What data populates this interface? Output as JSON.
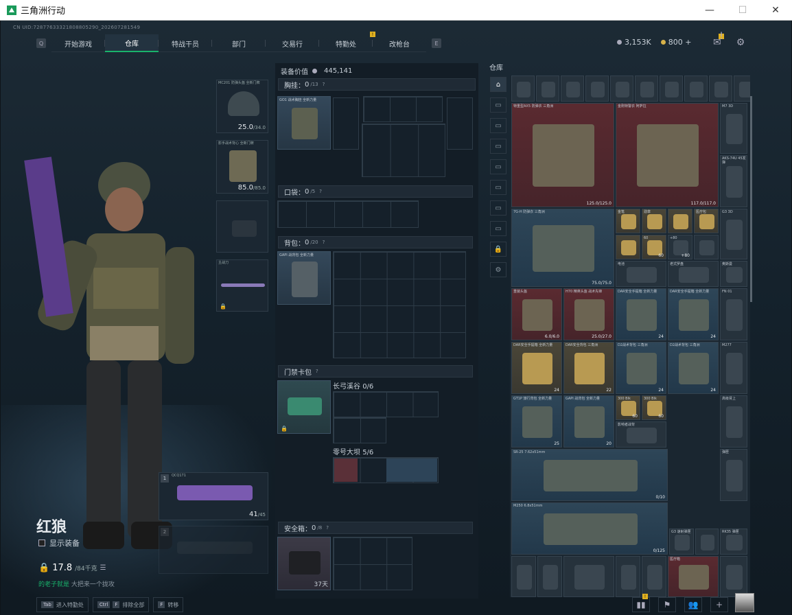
{
  "window": {
    "title": "三角洲行动",
    "min": "—",
    "max": "☐",
    "close": "✕"
  },
  "uid": "CN UID:72877633321808805290_202607281549",
  "nav": {
    "left_key": "Q",
    "right_key": "E",
    "tabs": [
      "开始游戏",
      "仓库",
      "特战干员",
      "部门",
      "交易行",
      "特勤处",
      "改枪台"
    ],
    "active": "仓库",
    "badge": "!"
  },
  "currency": {
    "silver": "3,153K",
    "gold": "800",
    "plus": "+"
  },
  "character": {
    "name": "红狼",
    "show_equipment": "显示装备",
    "weight": "17.8",
    "weight_max": "/84千克",
    "taunt_prefix": "",
    "taunt_main": "的老子就是",
    "taunt_suffix": "大把来一个拢攻"
  },
  "equip_slots": {
    "helmet": {
      "label": "MC201 防弹头盔 全新门牌",
      "value": "25.0",
      "max": "/34.0"
    },
    "armor": {
      "label": "影手战术背心 全新门牌",
      "value": "85.0",
      "max": "/85.0"
    },
    "pistol": {
      "label": ""
    },
    "melee": {
      "label": "主战刀"
    },
    "primary": {
      "label": "QCQ171",
      "value": "41",
      "max": "/45",
      "num": "1"
    },
    "secondary": {
      "num": "2"
    }
  },
  "loadout": {
    "value_label": "装备价值",
    "value": "445,141",
    "chest": {
      "label": "胸挂",
      "count": "0",
      "cap": "/13",
      "help": "?",
      "item": "GO1 战术胸挂 全新力量"
    },
    "pocket": {
      "label": "口袋",
      "count": "0",
      "cap": "/5",
      "help": "?"
    },
    "backpack": {
      "label": "背包",
      "count": "0",
      "cap": "/20",
      "help": "?",
      "item": "GAPI 战背包 全新力量"
    },
    "keycard": {
      "label": "门禁卡包",
      "help": "?",
      "sub1": "长弓溪谷",
      "sub1_count": "0/6",
      "sub2": "零号大坝",
      "sub2_count": "5/6"
    },
    "safe": {
      "label": "安全箱",
      "count": "0",
      "cap": "/8",
      "help": "?",
      "days": "37天"
    }
  },
  "warehouse": {
    "label": "仓库",
    "items": [
      {
        "label": "特重型AX5 防弹衣 三角洲",
        "value": "125.0/125.0"
      },
      {
        "label": "金刚特警衣 阿萨拉",
        "value": "117.0/117.0"
      },
      {
        "label": "M7 3D",
        "value": ""
      },
      {
        "label": "AKS-74U 45发弹",
        "value": ""
      },
      {
        "label": "7G-H 防弹衣 三角洲",
        "value": "75.0/75.0"
      },
      {
        "label": "金笔",
        "value": ""
      },
      {
        "label": "勋章",
        "value": ""
      },
      {
        "label": "G3 3D",
        "value": ""
      },
      {
        "label": "60",
        "value": "60"
      },
      {
        "label": "+80",
        "value": "+80"
      },
      {
        "label": "电池",
        "value": ""
      },
      {
        "label": "奥斯曼",
        "value": ""
      },
      {
        "label": "老式罗盘",
        "value": ""
      },
      {
        "label": "医疗包",
        "value": ""
      },
      {
        "label": "重装头盔",
        "value": "6.0/6.0"
      },
      {
        "label": "H70 精英头盔 战术先锋",
        "value": "25.0/27.0"
      },
      {
        "label": "DAR安全手提箱 全新力量",
        "value": "24"
      },
      {
        "label": "DAR安全手提箱 全新力量",
        "value": "24"
      },
      {
        "label": "FN 01",
        "value": ""
      },
      {
        "label": "DAR安全手提箱 全新力量",
        "value": "24"
      },
      {
        "label": "DAR安全背包 三角洲",
        "value": "22"
      },
      {
        "label": "D2战术背包 三角洲",
        "value": "24"
      },
      {
        "label": "D2战术背包 三角洲",
        "value": "24"
      },
      {
        "label": "M277",
        "value": ""
      },
      {
        "label": "GT1P 旅行背包 全新力量",
        "value": "25"
      },
      {
        "label": "GAPI 战背包 全新力量",
        "value": "20"
      },
      {
        "label": "300 Blk",
        "value": "60"
      },
      {
        "label": "300 Blk",
        "value": "60"
      },
      {
        "label": "影响者战背",
        "value": ""
      },
      {
        "label": "SR-25 7.62x51mm",
        "value": "0/10"
      },
      {
        "label": "M250 6.8x51mm",
        "value": "0/125"
      },
      {
        "label": "弹匣",
        "value": ""
      },
      {
        "label": "G3 速射弹匣",
        "value": ""
      },
      {
        "label": "RK35 弹匣",
        "value": ""
      },
      {
        "label": "高级肾上",
        "value": ""
      },
      {
        "label": "医疗箱",
        "value": ""
      }
    ]
  },
  "bottom": {
    "hint1_key": "Tab",
    "hint1": "进入特勤处",
    "hint2_key": "Ctrl",
    "hint2_key2": "F",
    "hint2": "排除全部",
    "hint3_key": "F",
    "hint3": "转移"
  },
  "icons": {
    "mail": "mail-icon",
    "settings": "gear-icon",
    "lock": "lock-icon"
  }
}
